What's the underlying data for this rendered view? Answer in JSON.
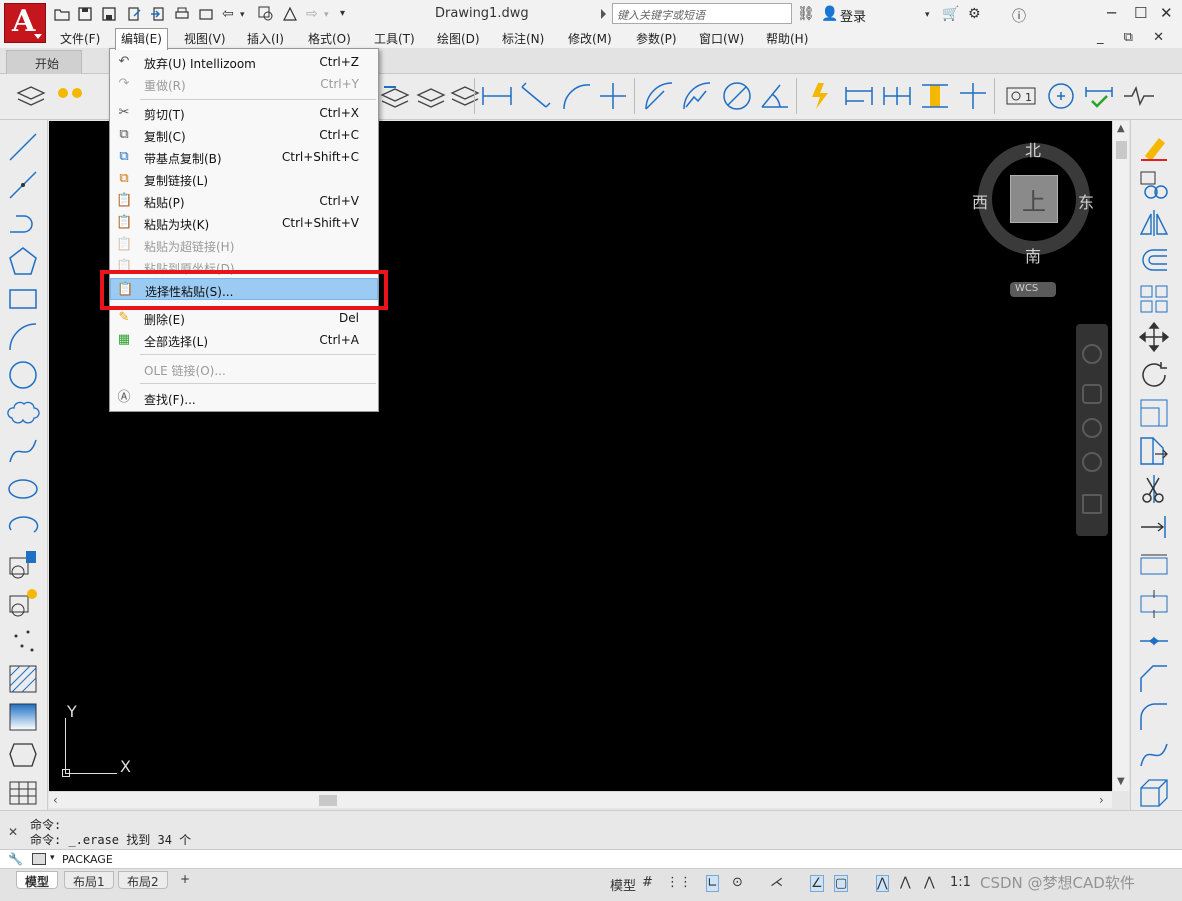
{
  "window": {
    "title": "Drawing1.dwg",
    "search_placeholder": "键入关键字或短语",
    "login_label": "登录",
    "minimize": "─",
    "maximize": "☐",
    "close": "✕"
  },
  "menubar": {
    "items": [
      "文件(F)",
      "编辑(E)",
      "视图(V)",
      "插入(I)",
      "格式(O)",
      "工具(T)",
      "绘图(D)",
      "标注(N)",
      "修改(M)",
      "参数(P)",
      "窗口(W)",
      "帮助(H)"
    ],
    "active_index": 1,
    "mdi_buttons": "_ ⧉ ✕"
  },
  "ribbon": {
    "tab_label": "开始"
  },
  "edit_menu": {
    "items": [
      {
        "label": "放弃(U) Intellizoom",
        "shortcut": "Ctrl+Z",
        "icon": "↶",
        "disabled": false
      },
      {
        "label": "重做(R)",
        "shortcut": "Ctrl+Y",
        "icon": "↷",
        "disabled": true
      },
      {
        "label": "剪切(T)",
        "shortcut": "Ctrl+X",
        "icon": "✂",
        "disabled": false
      },
      {
        "label": "复制(C)",
        "shortcut": "Ctrl+C",
        "icon": "⧉",
        "disabled": false
      },
      {
        "label": "带基点复制(B)",
        "shortcut": "Ctrl+Shift+C",
        "icon": "⧉",
        "disabled": false
      },
      {
        "label": "复制链接(L)",
        "shortcut": "",
        "icon": "⧉",
        "disabled": false
      },
      {
        "label": "粘贴(P)",
        "shortcut": "Ctrl+V",
        "icon": "📋",
        "disabled": false
      },
      {
        "label": "粘贴为块(K)",
        "shortcut": "Ctrl+Shift+V",
        "icon": "📋",
        "disabled": false
      },
      {
        "label": "粘贴为超链接(H)",
        "shortcut": "",
        "icon": "📋",
        "disabled": true
      },
      {
        "label": "粘贴到原坐标(D)",
        "shortcut": "",
        "icon": "📋",
        "disabled": true
      },
      {
        "label": "选择性粘贴(S)...",
        "shortcut": "",
        "icon": "📋",
        "disabled": false,
        "highlighted": true
      },
      {
        "label": "删除(E)",
        "shortcut": "Del",
        "icon": "✎",
        "disabled": false
      },
      {
        "label": "全部选择(L)",
        "shortcut": "Ctrl+A",
        "icon": "▦",
        "disabled": false
      },
      {
        "label": "OLE 链接(O)...",
        "shortcut": "",
        "icon": "",
        "disabled": true
      },
      {
        "label": "查找(F)...",
        "shortcut": "",
        "icon": "Ⓐ",
        "disabled": false
      }
    ]
  },
  "viewcube": {
    "north": "北",
    "south": "南",
    "east": "东",
    "west": "西",
    "face": "上",
    "wcs": "WCS"
  },
  "ucs": {
    "x": "X",
    "y": "Y"
  },
  "command": {
    "history": [
      "命令:",
      "命令: _.erase 找到 34 个"
    ],
    "prompt": "PACKAGE"
  },
  "layout_tabs": [
    "模型",
    "布局1",
    "布局2",
    "+"
  ],
  "status": {
    "model": "模型",
    "scale": "1:1"
  },
  "watermark": "CSDN @梦想CAD软件",
  "colors": {
    "canvas": "#000000",
    "highlight": "#9bcbf2",
    "callout": "#e8141a",
    "logo": "#c4161c"
  }
}
